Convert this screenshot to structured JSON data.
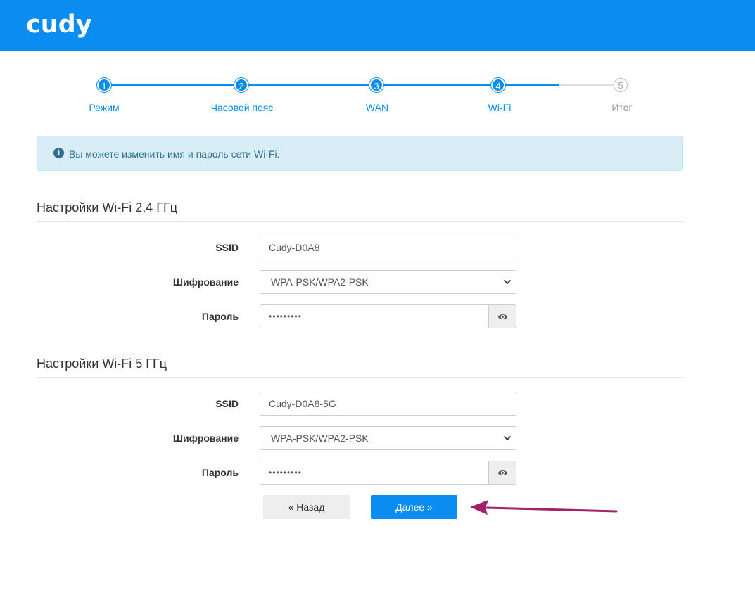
{
  "brand": {
    "logo_text": "cudy"
  },
  "steps": [
    {
      "number": "1",
      "label": "Режим",
      "state": "active"
    },
    {
      "number": "2",
      "label": "Часовой пояс",
      "state": "active"
    },
    {
      "number": "3",
      "label": "WAN",
      "state": "active"
    },
    {
      "number": "4",
      "label": "Wi-Fi",
      "state": "active"
    },
    {
      "number": "5",
      "label": "Итог",
      "state": "inactive"
    }
  ],
  "alert": {
    "icon": "info-icon",
    "text": "Вы можете изменить имя и пароль сети Wi-Fi."
  },
  "wifi24": {
    "title": "Настройки Wi-Fi 2,4 ГГц",
    "ssid_label": "SSID",
    "ssid_value": "Cudy-D0A8",
    "encryption_label": "Шифрование",
    "encryption_value": "WPA-PSK/WPA2-PSK",
    "password_label": "Пароль",
    "password_value": "•••••••••"
  },
  "wifi5": {
    "title": "Настройки Wi-Fi 5 ГГц",
    "ssid_label": "SSID",
    "ssid_value": "Cudy-D0A8-5G",
    "encryption_label": "Шифрование",
    "encryption_value": "WPA-PSK/WPA2-PSK",
    "password_label": "Пароль",
    "password_value": "•••••••••"
  },
  "buttons": {
    "back_label": "« Назад",
    "next_label": "Далее »"
  },
  "colors": {
    "brand": "#0a8cf0",
    "alert_bg": "#d9edf7",
    "alert_text": "#31708f",
    "annotation_arrow": "#a0226a"
  }
}
